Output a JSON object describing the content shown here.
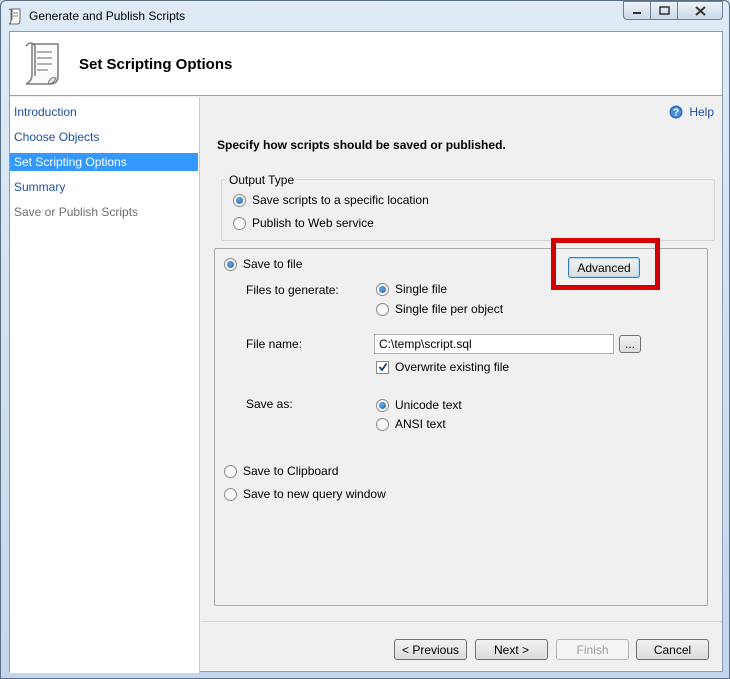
{
  "window": {
    "title": "Generate and Publish Scripts"
  },
  "header": {
    "page_title": "Set Scripting Options"
  },
  "nav": {
    "items": [
      {
        "label": "Introduction",
        "state": "normal"
      },
      {
        "label": "Choose Objects",
        "state": "normal"
      },
      {
        "label": "Set Scripting Options",
        "state": "selected"
      },
      {
        "label": "Summary",
        "state": "normal"
      },
      {
        "label": "Save or Publish Scripts",
        "state": "disabled"
      }
    ]
  },
  "help": {
    "label": "Help"
  },
  "instruction": "Specify how scripts should be saved or published.",
  "output_type": {
    "legend": "Output Type",
    "options": [
      {
        "label": "Save scripts to a specific location",
        "selected": true
      },
      {
        "label": "Publish to Web service",
        "selected": false
      }
    ]
  },
  "save_options": {
    "save_to_file": {
      "label": "Save to file",
      "selected": true
    },
    "advanced_button": "Advanced",
    "files_to_generate": {
      "label": "Files to generate:",
      "options": [
        {
          "label": "Single file",
          "selected": true
        },
        {
          "label": "Single file per object",
          "selected": false
        }
      ]
    },
    "file_name": {
      "label": "File name:",
      "value": "C:\\temp\\script.sql",
      "browse_label": "..."
    },
    "overwrite": {
      "label": "Overwrite existing file",
      "checked": true
    },
    "save_as": {
      "label": "Save as:",
      "options": [
        {
          "label": "Unicode text",
          "selected": true
        },
        {
          "label": "ANSI text",
          "selected": false
        }
      ]
    },
    "save_to_clipboard": {
      "label": "Save to Clipboard",
      "selected": false
    },
    "save_to_query_window": {
      "label": "Save to new query window",
      "selected": false
    }
  },
  "buttons": {
    "previous": "< Previous",
    "next": "Next >",
    "finish": "Finish",
    "cancel": "Cancel"
  },
  "colors": {
    "selection": "#3399ff",
    "nav_link": "#1f4fa5",
    "annotation_red": "#d40000"
  }
}
